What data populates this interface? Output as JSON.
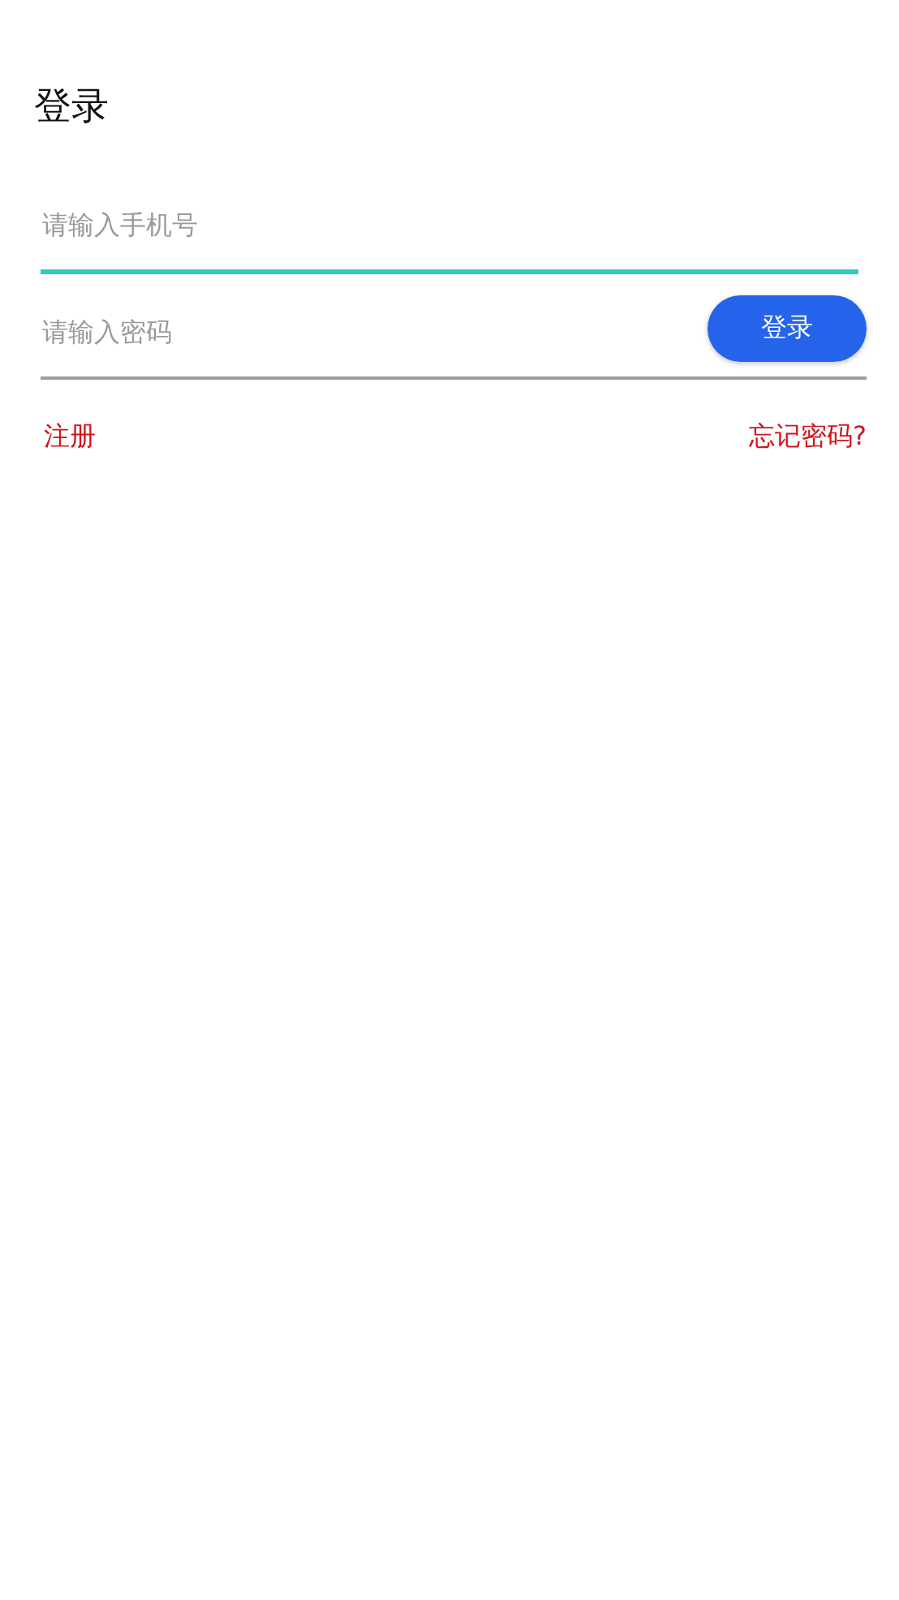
{
  "title": "登录",
  "fields": [
    {
      "placeholder": "请输入手机号",
      "focused": true
    },
    {
      "placeholder": "请输入密码",
      "focused": false
    }
  ],
  "login_button": "登录",
  "links": {
    "register": "注册",
    "forgot_password": "忘记密码?"
  }
}
